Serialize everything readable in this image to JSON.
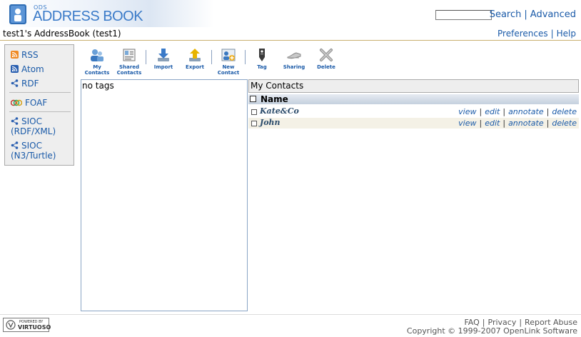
{
  "header": {
    "brand_small": "ODS",
    "brand_big": "ADDRESS BOOK",
    "search_link": "Search",
    "advanced_link": "Advanced",
    "owner_title": "test1's AddressBook (test1)",
    "preferences_link": "Preferences",
    "help_link": "Help",
    "separator": "|"
  },
  "sidebar": {
    "rss": "RSS",
    "atom": "Atom",
    "rdf": "RDF",
    "foaf": "FOAF",
    "sioc_rdf_1": "SIOC",
    "sioc_rdf_2": "(RDF/XML)",
    "sioc_n3_1": "SIOC",
    "sioc_n3_2": "(N3/Turtle)"
  },
  "toolbar": {
    "my_contacts_1": "My Contacts",
    "shared_contacts_1": "Shared",
    "shared_contacts_2": "Contacts",
    "import": "Import",
    "export": "Export",
    "new_contact_1": "New",
    "new_contact_2": "Contact",
    "tag": "Tag",
    "sharing": "Sharing",
    "delete": "Delete"
  },
  "tags_panel": {
    "empty_text": "no tags"
  },
  "contacts": {
    "title": "My Contacts",
    "column_name": "Name",
    "rows": [
      {
        "name": "Kate&Co"
      },
      {
        "name": "John"
      }
    ],
    "actions": {
      "view": "view",
      "edit": "edit",
      "annotate": "annotate",
      "delete": "delete"
    }
  },
  "footer": {
    "badge_top": "POWERED BY",
    "badge_name": "VIRTUOSO",
    "faq": "FAQ",
    "privacy": "Privacy",
    "report_abuse": "Report Abuse",
    "copyright": "Copyright © 1999-2007 OpenLink Software"
  },
  "colors": {
    "link": "#1a5aa8",
    "brand": "#3a7ac8",
    "header_rule": "#c9b070"
  }
}
